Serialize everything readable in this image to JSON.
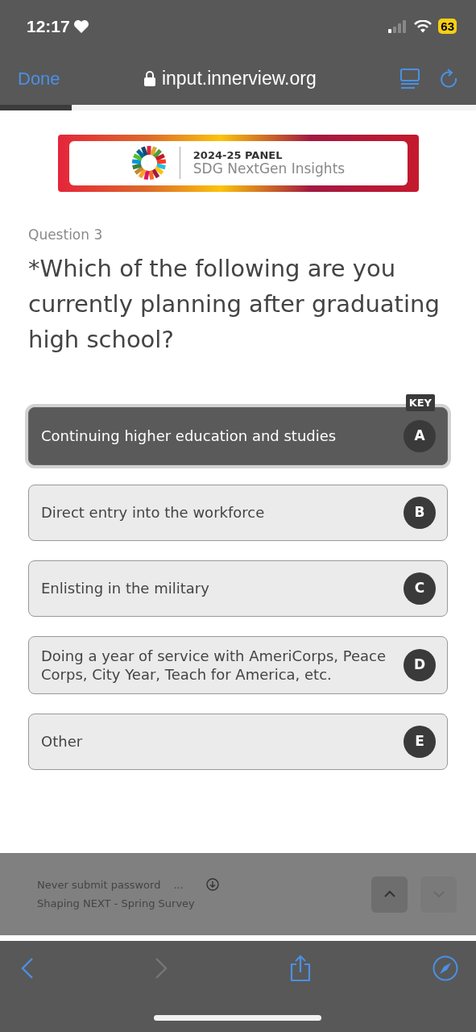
{
  "status_bar": {
    "time": "12:17",
    "battery": "63"
  },
  "browser_bar": {
    "done": "Done",
    "url": "input.innerview.org"
  },
  "progress": {
    "level": 0.15
  },
  "banner": {
    "title": "2024-25 **PANEL**",
    "subtitle": "SDG NextGen Insights"
  },
  "question": {
    "number": "Question 3",
    "text": "*Which of the following are you currently planning after graduating high school?"
  },
  "key_badge": "KEY",
  "options": [
    {
      "label": "Continuing higher education and studies",
      "key": "A",
      "selected": true
    },
    {
      "label": "Direct entry into the workforce",
      "key": "B",
      "selected": false
    },
    {
      "label": "Enlisting in the military",
      "key": "C",
      "selected": false
    },
    {
      "label": "Doing a year of service with AmeriCorps, Peace Corps, City Year, Teach for America, etc.",
      "key": "D",
      "selected": false
    },
    {
      "label": "Other",
      "key": "E",
      "selected": false
    }
  ],
  "footer": {
    "line_1": "Never submit password",
    "ellipsis": "...",
    "line_2": "Shaping NEXT - Spring Survey",
    "buttons": [
      {
        "kind": "up",
        "disabled": false
      },
      {
        "kind": "down",
        "disabled": true
      }
    ]
  },
  "toolbar": {
    "back_disabled": false,
    "forward_disabled": true
  }
}
